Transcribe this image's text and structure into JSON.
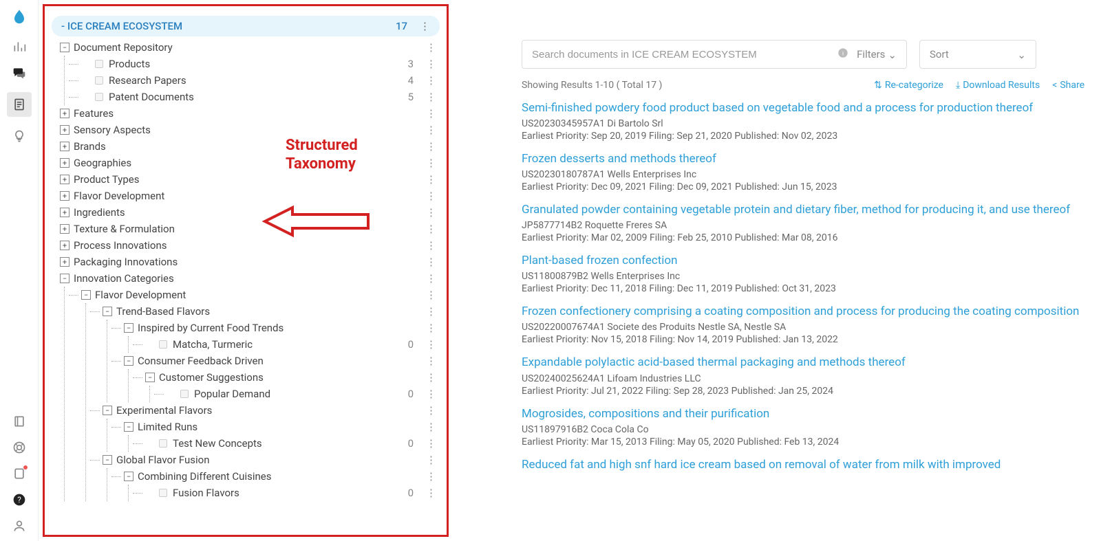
{
  "annotation": {
    "line1": "Structured",
    "line2": "Taxonomy"
  },
  "tree": {
    "root": {
      "label": "- ICE CREAM ECOSYSTEM",
      "count": 17
    },
    "nodes": [
      {
        "label": "Document Repository",
        "exp": "−",
        "children": [
          {
            "label": "Products",
            "leaf": true,
            "count": 3
          },
          {
            "label": "Research Papers",
            "leaf": true,
            "count": 4
          },
          {
            "label": "Patent Documents",
            "leaf": true,
            "count": 5
          }
        ]
      },
      {
        "label": "Features",
        "exp": "+"
      },
      {
        "label": "Sensory Aspects",
        "exp": "+"
      },
      {
        "label": "Brands",
        "exp": "+"
      },
      {
        "label": "Geographies",
        "exp": "+"
      },
      {
        "label": "Product Types",
        "exp": "+"
      },
      {
        "label": "Flavor Development",
        "exp": "+"
      },
      {
        "label": "Ingredients",
        "exp": "+"
      },
      {
        "label": "Texture & Formulation",
        "exp": "+"
      },
      {
        "label": "Process Innovations",
        "exp": "+"
      },
      {
        "label": "Packaging Innovations",
        "exp": "+"
      },
      {
        "label": "Innovation Categories",
        "exp": "−",
        "children": [
          {
            "label": "Flavor Development",
            "exp": "−",
            "children": [
              {
                "label": "Trend-Based Flavors",
                "exp": "−",
                "children": [
                  {
                    "label": "Inspired by Current Food Trends",
                    "exp": "−",
                    "children": [
                      {
                        "label": "Matcha, Turmeric",
                        "leaf": true,
                        "count": 0
                      }
                    ]
                  },
                  {
                    "label": "Consumer Feedback Driven",
                    "exp": "−",
                    "children": [
                      {
                        "label": "Customer Suggestions",
                        "exp": "−",
                        "children": [
                          {
                            "label": "Popular Demand",
                            "leaf": true,
                            "count": 0
                          }
                        ]
                      }
                    ]
                  }
                ]
              },
              {
                "label": "Experimental Flavors",
                "exp": "−",
                "children": [
                  {
                    "label": "Limited Runs",
                    "exp": "−",
                    "children": [
                      {
                        "label": "Test New Concepts",
                        "leaf": true,
                        "count": 0
                      }
                    ]
                  }
                ]
              },
              {
                "label": "Global Flavor Fusion",
                "exp": "−",
                "children": [
                  {
                    "label": "Combining Different Cuisines",
                    "exp": "−",
                    "children": [
                      {
                        "label": "Fusion Flavors",
                        "leaf": true,
                        "count": 0
                      }
                    ]
                  }
                ]
              }
            ]
          }
        ]
      }
    ]
  },
  "search": {
    "placeholder": "Search documents in ICE CREAM ECOSYSTEM",
    "filters_label": "Filters",
    "sort_label": "Sort"
  },
  "results_header": {
    "summary": "Showing Results 1-10 ( Total 17 )",
    "recategorize": "Re-categorize",
    "download": "Download Results",
    "share": "Share"
  },
  "results": [
    {
      "title": "Semi-finished powdery food product based on vegetable food and a process for production thereof",
      "id": "US20230345957A1",
      "assignee": "Di Bartolo Srl",
      "priority": "Sep 20, 2019",
      "filing": "Sep 21, 2020",
      "published": "Nov 02, 2023"
    },
    {
      "title": "Frozen desserts and methods thereof",
      "id": "US20230180787A1",
      "assignee": "Wells Enterprises Inc",
      "priority": "Dec 09, 2021",
      "filing": "Dec 09, 2021",
      "published": "Jun 15, 2023"
    },
    {
      "title": "Granulated powder containing vegetable protein and dietary fiber, method for producing it, and use thereof",
      "id": "JP5877714B2",
      "assignee": "Roquette Freres SA",
      "priority": "Mar 02, 2009",
      "filing": "Feb 25, 2010",
      "published": "Mar 08, 2016"
    },
    {
      "title": "Plant-based frozen confection",
      "id": "US11800879B2",
      "assignee": "Wells Enterprises Inc",
      "priority": "Dec 11, 2018",
      "filing": "Dec 11, 2019",
      "published": "Oct 31, 2023"
    },
    {
      "title": "Frozen confectionery comprising a coating composition and process for producing the coating composition",
      "id": "US20220007674A1",
      "assignee": "Societe des Produits Nestle SA, Nestle SA",
      "priority": "Nov 15, 2018",
      "filing": "Nov 14, 2019",
      "published": "Jan 13, 2022"
    },
    {
      "title": "Expandable polylactic acid-based thermal packaging and methods thereof",
      "id": "US20240025624A1",
      "assignee": "Lifoam Industries LLC",
      "priority": "Jul 21, 2022",
      "filing": "Sep 28, 2023",
      "published": "Jan 25, 2024"
    },
    {
      "title": "Mogrosides, compositions and their purification",
      "id": "US11897916B2",
      "assignee": "Coca Cola Co",
      "priority": "Mar 15, 2013",
      "filing": "May 05, 2020",
      "published": "Feb 13, 2024"
    },
    {
      "title": "Reduced fat and high snf hard ice cream based on removal of water from milk with improved",
      "id": "",
      "assignee": "",
      "priority": "",
      "filing": "",
      "published": ""
    }
  ],
  "labels": {
    "priority": "Earliest Priority:",
    "filing": "Filing:",
    "published": "Published:"
  }
}
